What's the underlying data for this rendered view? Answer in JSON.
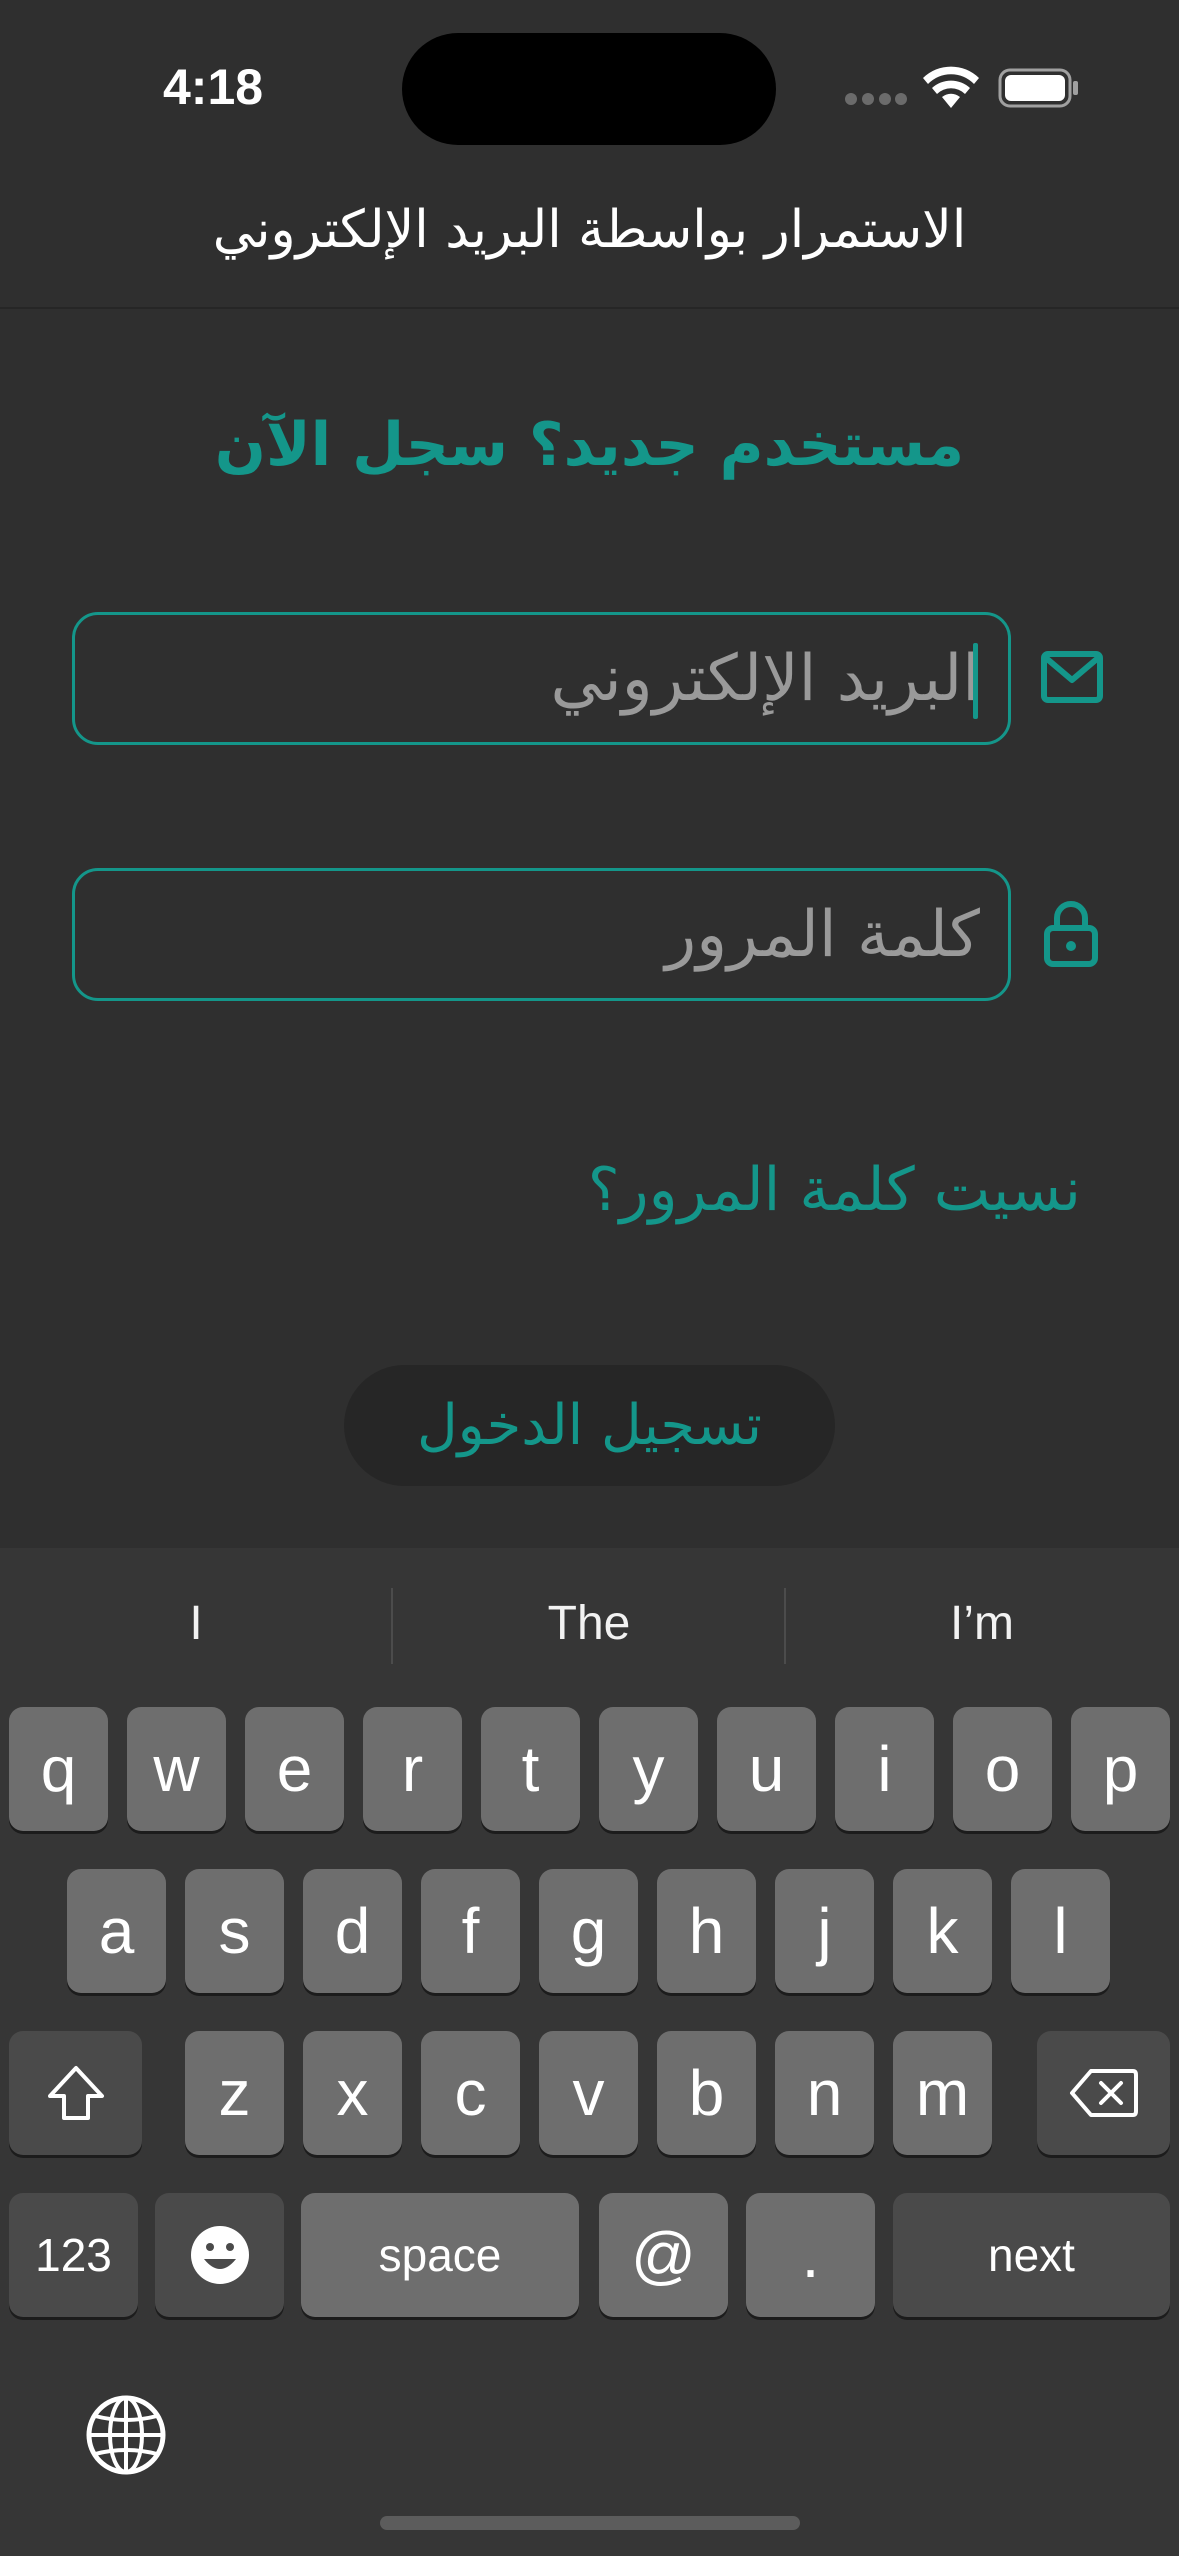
{
  "status_bar": {
    "time": "4:18"
  },
  "header": {
    "title": "الاستمرار بواسطة البريد الإلكتروني"
  },
  "form": {
    "register_link": "مستخدم جديد؟ سجل الآن",
    "email_placeholder": "البريد الإلكتروني",
    "email_icon": "mail-icon",
    "password_placeholder": "كلمة المرور",
    "password_icon": "lock-icon",
    "forgot_password": "نسيت كلمة المرور؟",
    "login_button": "تسجيل الدخول",
    "accent_color": "#14968a"
  },
  "keyboard": {
    "suggestions": [
      "I",
      "The",
      "I’m"
    ],
    "row1": [
      "q",
      "w",
      "e",
      "r",
      "t",
      "y",
      "u",
      "i",
      "o",
      "p"
    ],
    "row2": [
      "a",
      "s",
      "d",
      "f",
      "g",
      "h",
      "j",
      "k",
      "l"
    ],
    "row3": [
      "z",
      "x",
      "c",
      "v",
      "b",
      "n",
      "m"
    ],
    "numbers_key": "123",
    "emoji_icon": "emoji-icon",
    "space_key": "space",
    "at_key": "@",
    "period_key": ".",
    "next_key": "next",
    "shift_icon": "shift-icon",
    "delete_icon": "delete-icon",
    "globe_icon": "globe-icon"
  }
}
